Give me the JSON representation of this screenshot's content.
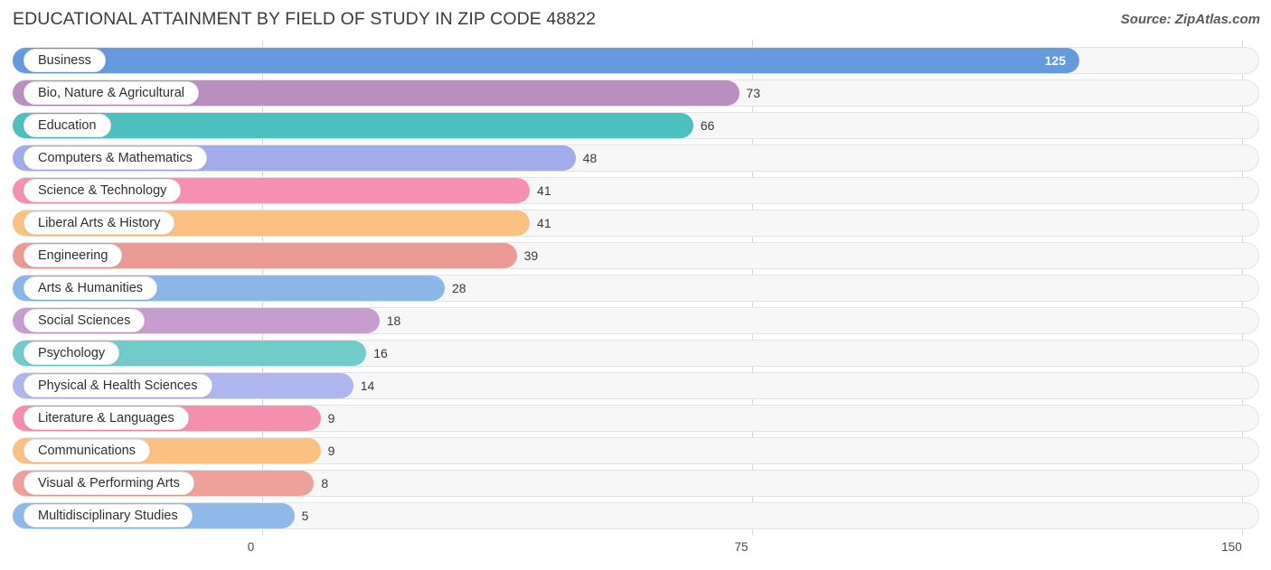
{
  "header": {
    "title": "EDUCATIONAL ATTAINMENT BY FIELD OF STUDY IN ZIP CODE 48822",
    "source": "Source: ZipAtlas.com"
  },
  "chart_data": {
    "type": "bar",
    "orientation": "horizontal",
    "title": "EDUCATIONAL ATTAINMENT BY FIELD OF STUDY IN ZIP CODE 48822",
    "subtitle": "Source: ZipAtlas.com",
    "xlabel": "",
    "ylabel": "",
    "xlim": [
      0,
      150
    ],
    "ticks": [
      "0",
      "75",
      "150"
    ],
    "tick_values": [
      0,
      75,
      150
    ],
    "grid": true,
    "legend": false,
    "categories": [
      "Business",
      "Bio, Nature & Agricultural",
      "Education",
      "Computers & Mathematics",
      "Science & Technology",
      "Liberal Arts & History",
      "Engineering",
      "Arts & Humanities",
      "Social Sciences",
      "Psychology",
      "Physical & Health Sciences",
      "Literature & Languages",
      "Communications",
      "Visual & Performing Arts",
      "Multidisciplinary Studies"
    ],
    "values": [
      125,
      73,
      66,
      48,
      41,
      41,
      39,
      28,
      18,
      16,
      14,
      9,
      9,
      8,
      5
    ],
    "value_labels": [
      "125",
      "73",
      "66",
      "48",
      "41",
      "41",
      "39",
      "28",
      "18",
      "16",
      "14",
      "9",
      "9",
      "8",
      "5"
    ],
    "colors": [
      "#6699dd",
      "#b98fc0",
      "#4fc0c0",
      "#a3acea",
      "#f78fb3",
      "#fbc182",
      "#ec9a95",
      "#8ab6e8",
      "#c79cce",
      "#72cbcb",
      "#aeb5ef",
      "#f58fae",
      "#fbc182",
      "#eea09a",
      "#8fb9e8"
    ]
  }
}
